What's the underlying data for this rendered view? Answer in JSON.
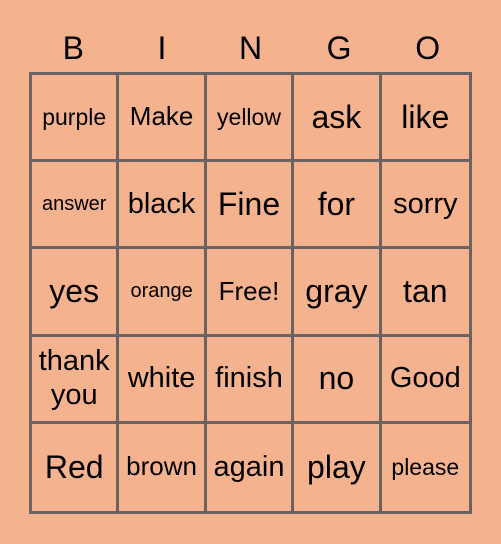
{
  "header": [
    "B",
    "I",
    "N",
    "G",
    "O"
  ],
  "colors": {
    "background": "#F4B28E",
    "grid_line": "#6B6361",
    "text": "#000000"
  },
  "cells": [
    [
      "purple",
      "Make",
      "yellow",
      "ask",
      "like"
    ],
    [
      "answer",
      "black",
      "Fine",
      "for",
      "sorry"
    ],
    [
      "yes",
      "orange",
      "Free!",
      "gray",
      "tan"
    ],
    [
      "thank you",
      "white",
      "finish",
      "no",
      "Good"
    ],
    [
      "Red",
      "brown",
      "again",
      "play",
      "please"
    ]
  ]
}
